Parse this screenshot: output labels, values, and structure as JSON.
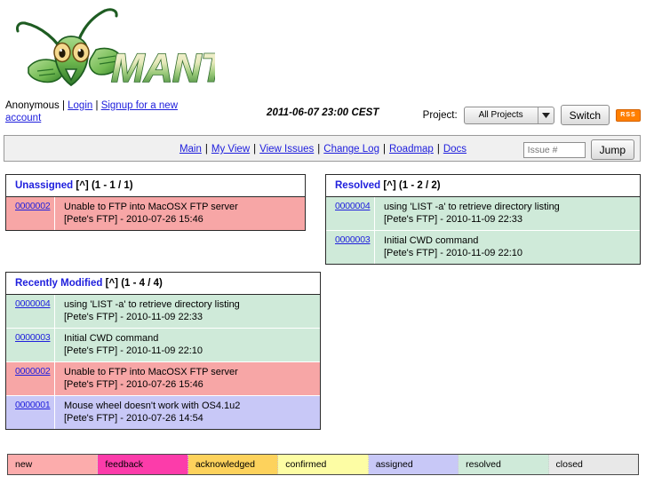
{
  "app": {
    "name": "MANTIS",
    "logo_alt": "mantis-bug-tracker-logo"
  },
  "header": {
    "user_name": "Anonymous",
    "separator": "|",
    "login_label": "Login",
    "signup_label": "Signup for a new account",
    "timestamp": "2011-06-07 23:00 CEST",
    "project_label": "Project:",
    "project_selected": "All Projects",
    "switch_label": "Switch",
    "rss_label": "RSS"
  },
  "nav": {
    "items": [
      {
        "label": "Main"
      },
      {
        "label": "My View"
      },
      {
        "label": "View Issues"
      },
      {
        "label": "Change Log"
      },
      {
        "label": "Roadmap"
      },
      {
        "label": "Docs"
      }
    ],
    "separator": "|",
    "issue_placeholder": "Issue #",
    "issue_value": "",
    "jump_label": "Jump"
  },
  "panels": [
    {
      "id": "unassigned",
      "title": "Unassigned",
      "collapse_label": "[^]",
      "count_label": "(1 - 1 / 1)",
      "rows": [
        {
          "id": "0000002",
          "summary": "Unable to FTP into MacOSX FTP server",
          "meta": "[Pete's FTP] - 2010-07-26 15:46",
          "status": "new",
          "color": "#f7a6a6"
        }
      ]
    },
    {
      "id": "resolved",
      "title": "Resolved",
      "collapse_label": "[^]",
      "count_label": "(1 - 2 / 2)",
      "rows": [
        {
          "id": "0000004",
          "summary": "using 'LIST -a' to retrieve directory listing",
          "meta": "[Pete's FTP] - 2010-11-09 22:33",
          "status": "resolved",
          "color": "#cfead9"
        },
        {
          "id": "0000003",
          "summary": "Initial CWD command",
          "meta": "[Pete's FTP] - 2010-11-09 22:10",
          "status": "resolved",
          "color": "#cfead9"
        }
      ]
    },
    {
      "id": "recently-modified",
      "title": "Recently Modified",
      "collapse_label": "[^]",
      "count_label": "(1 - 4 / 4)",
      "rows": [
        {
          "id": "0000004",
          "summary": "using 'LIST -a' to retrieve directory listing",
          "meta": "[Pete's FTP] - 2010-11-09 22:33",
          "status": "resolved",
          "color": "#cfead9"
        },
        {
          "id": "0000003",
          "summary": "Initial CWD command",
          "meta": "[Pete's FTP] - 2010-11-09 22:10",
          "status": "resolved",
          "color": "#cfead9"
        },
        {
          "id": "0000002",
          "summary": "Unable to FTP into MacOSX FTP server",
          "meta": "[Pete's FTP] - 2010-07-26 15:46",
          "status": "new",
          "color": "#f7a6a6"
        },
        {
          "id": "0000001",
          "summary": "Mouse wheel doesn't work with OS4.1u2",
          "meta": "[Pete's FTP] - 2010-07-26 14:54",
          "status": "assigned",
          "color": "#c8c8f7"
        }
      ]
    }
  ],
  "legend": [
    {
      "label": "new",
      "color": "#fcacac"
    },
    {
      "label": "feedback",
      "color": "#fc3caa"
    },
    {
      "label": "acknowledged",
      "color": "#fdd25c"
    },
    {
      "label": "confirmed",
      "color": "#fdfda4"
    },
    {
      "label": "assigned",
      "color": "#c8c8f7"
    },
    {
      "label": "resolved",
      "color": "#cfead9"
    },
    {
      "label": "closed",
      "color": "#e8e8e8"
    }
  ]
}
